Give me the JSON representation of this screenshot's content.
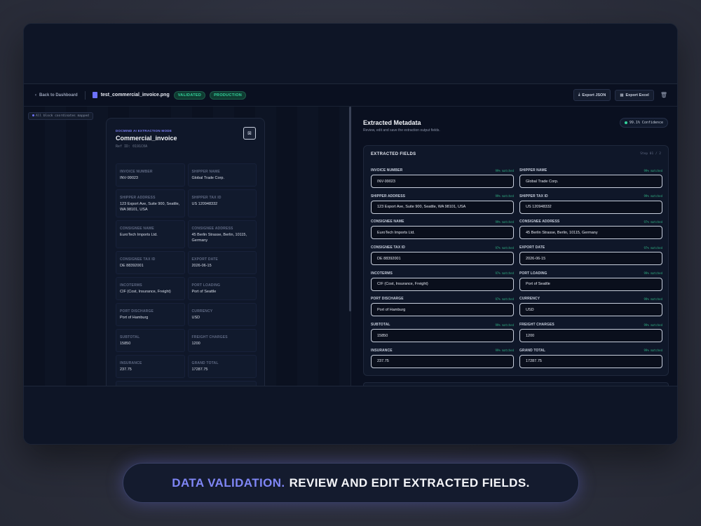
{
  "header": {
    "back_label": "Back to Dashboard",
    "file_name": "test_commercial_invoice.png",
    "badge_validated": "VALIDATED",
    "badge_production": "PRODUCTION",
    "export_json": "Export JSON",
    "export_excel": "Export Excel"
  },
  "left": {
    "coord_hint": "All block coordinates mapped",
    "mode": "DOCMIND AI EXTRACTION MODE",
    "doc_title": "Commercial_invoice",
    "ref": "Ref ID: 0191C0A",
    "fields": [
      {
        "label": "INVOICE NUMBER",
        "value": "INV-99023"
      },
      {
        "label": "SHIPPER NAME",
        "value": "Global Trade Corp."
      },
      {
        "label": "SHIPPER ADDRESS",
        "value": "123 Export Ave, Suite 900, Seattle, WA 98101, USA"
      },
      {
        "label": "SHIPPER TAX ID",
        "value": "US 120948332"
      },
      {
        "label": "CONSIGNEE NAME",
        "value": "EuroTech Imports Ltd."
      },
      {
        "label": "CONSIGNEE ADDRESS",
        "value": "45 Berlin Strasse, Berlin, 10115, Germany"
      },
      {
        "label": "CONSIGNEE TAX ID",
        "value": "DE 88392001"
      },
      {
        "label": "EXPORT DATE",
        "value": "2026-06-15"
      },
      {
        "label": "INCOTERMS",
        "value": "CIF (Cost, Insurance, Freight)"
      },
      {
        "label": "PORT LOADING",
        "value": "Port of Seattle"
      },
      {
        "label": "PORT DISCHARGE",
        "value": "Port of Hamburg"
      },
      {
        "label": "CURRENCY",
        "value": "USD"
      },
      {
        "label": "SUBTOTAL",
        "value": "15850"
      },
      {
        "label": "FREIGHT CHARGES",
        "value": "1200"
      },
      {
        "label": "INSURANCE",
        "value": "237.75"
      },
      {
        "label": "GRAND TOTAL",
        "value": "17287.75"
      }
    ]
  },
  "right": {
    "title": "Extracted Metadata",
    "subtitle": "Review, edit and save the extraction output fields.",
    "confidence": "99.1% Confidence",
    "panel_title": "EXTRACTED FIELDS",
    "panel_meta": "Step 01 / 2",
    "fields": [
      {
        "label": "INVOICE NUMBER",
        "conf": "99% matched",
        "value": "INV-99023"
      },
      {
        "label": "SHIPPER NAME",
        "conf": "99% matched",
        "value": "Global Trade Corp."
      },
      {
        "label": "SHIPPER ADDRESS",
        "conf": "99% matched",
        "value": "123 Export Ave, Suite 900, Seattle, WA 98101, USA"
      },
      {
        "label": "SHIPPER TAX ID",
        "conf": "99% matched",
        "value": "US 120948332"
      },
      {
        "label": "CONSIGNEE NAME",
        "conf": "99% matched",
        "value": "EuroTech Imports Ltd."
      },
      {
        "label": "CONSIGNEE ADDRESS",
        "conf": "97% matched",
        "value": "45 Berlin Strasse, Berlin, 10115, Germany"
      },
      {
        "label": "CONSIGNEE TAX ID",
        "conf": "97% matched",
        "value": "DE 88392001"
      },
      {
        "label": "EXPORT DATE",
        "conf": "97% matched",
        "value": "2026-06-15"
      },
      {
        "label": "INCOTERMS",
        "conf": "97% matched",
        "value": "CIF (Cost, Insurance, Freight)"
      },
      {
        "label": "PORT LOADING",
        "conf": "99% matched",
        "value": "Port of Seattle"
      },
      {
        "label": "PORT DISCHARGE",
        "conf": "97% matched",
        "value": "Port of Hamburg"
      },
      {
        "label": "CURRENCY",
        "conf": "99% matched",
        "value": "USD"
      },
      {
        "label": "SUBTOTAL",
        "conf": "99% matched",
        "value": "15850"
      },
      {
        "label": "FREIGHT CHARGES",
        "conf": "99% matched",
        "value": "1200"
      },
      {
        "label": "INSURANCE",
        "conf": "99% matched",
        "value": "237.75"
      },
      {
        "label": "GRAND TOTAL",
        "conf": "99% matched",
        "value": "17287.75"
      }
    ]
  },
  "caption": {
    "accent": "DATA VALIDATION.",
    "main": "REVIEW AND EDIT EXTRACTED FIELDS."
  },
  "colors": {
    "accent": "#7f86f5",
    "success": "#34d39c",
    "background": "#0a1020"
  }
}
